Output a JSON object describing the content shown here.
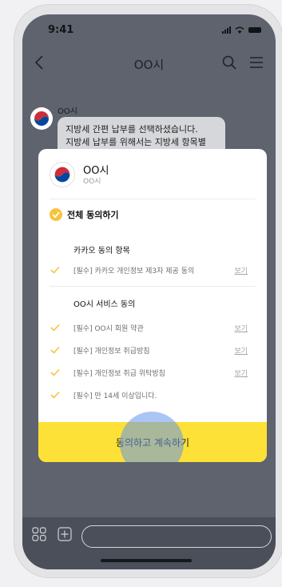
{
  "status": {
    "time": "9:41"
  },
  "nav": {
    "title": "OO시"
  },
  "chat": {
    "sender": "OO시",
    "message_line1": "지방세 간편 납부를 선택하셨습니다.",
    "message_line2": "지방세 납부를 위해서는 지방세 항목별"
  },
  "modal": {
    "org_name": "OO시",
    "org_sub": "OO시",
    "agree_all": "전체 동의하기",
    "group1": {
      "title": "카카오 동의 항목",
      "items": [
        {
          "label": "[필수] 카카오 개인정보 제3자 제공 동의",
          "view": "보기"
        }
      ]
    },
    "group2": {
      "title": "OO시 서비스 동의",
      "items": [
        {
          "label": "[필수] OO시 회원 약관",
          "view": "보기"
        },
        {
          "label": "[필수] 개인정보 취급방침",
          "view": "보기"
        },
        {
          "label": "[필수] 개인정보 취급 위탁방침",
          "view": "보기"
        },
        {
          "label": "[필수] 만 14세 이상입니다."
        }
      ]
    },
    "cta": "동의하고 계속하기"
  },
  "colors": {
    "accent_yellow": "#FDE136",
    "check_orange": "#F8C33C",
    "backdrop": "#5E636E"
  }
}
